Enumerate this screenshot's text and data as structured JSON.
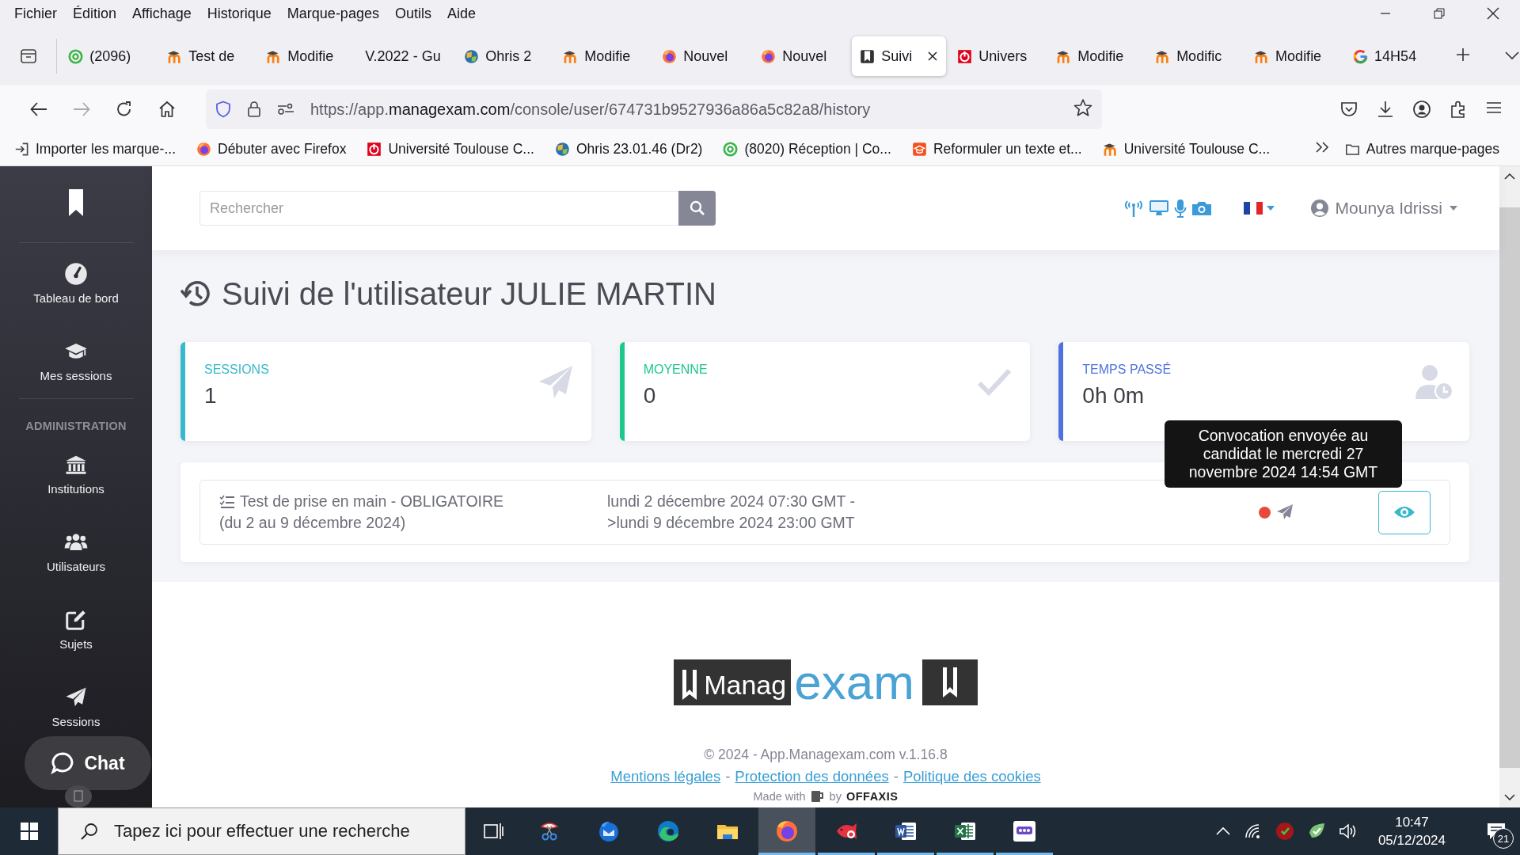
{
  "menu_bar": [
    "Fichier",
    "Édition",
    "Affichage",
    "Historique",
    "Marque-pages",
    "Outils",
    "Aide"
  ],
  "tabs": [
    {
      "label": "(2096)",
      "kind": "target",
      "selected": false
    },
    {
      "label": "Test de",
      "kind": "moodle",
      "selected": false
    },
    {
      "label": "Modifie",
      "kind": "moodle",
      "selected": false
    },
    {
      "label": "V.2022 - Gu",
      "kind": "none",
      "selected": false
    },
    {
      "label": "Ohris 2",
      "kind": "ohris",
      "selected": false
    },
    {
      "label": "Modifie",
      "kind": "moodle",
      "selected": false
    },
    {
      "label": "Nouvel",
      "kind": "firefox",
      "selected": false
    },
    {
      "label": "Nouvel",
      "kind": "firefox",
      "selected": false
    },
    {
      "label": "Suivi",
      "kind": "managexam",
      "selected": true
    },
    {
      "label": "Univers",
      "kind": "toulouse",
      "selected": false
    },
    {
      "label": "Modifie",
      "kind": "moodle",
      "selected": false
    },
    {
      "label": "Modific",
      "kind": "moodle",
      "selected": false
    },
    {
      "label": "Modifie",
      "kind": "moodle",
      "selected": false
    },
    {
      "label": "14H54",
      "kind": "google",
      "selected": false
    }
  ],
  "address_bar": {
    "prefix": "https://app.",
    "domain": "managexam.com",
    "path": "/console/user/674731b9527936a86a5c82a8/history"
  },
  "bookmarks": [
    {
      "label": "Importer les marque-...",
      "kind": "import"
    },
    {
      "label": "Débuter avec Firefox",
      "kind": "firefox"
    },
    {
      "label": "Université Toulouse C...",
      "kind": "toulouse"
    },
    {
      "label": "Ohris 23.01.46 (Dr2)",
      "kind": "ohris"
    },
    {
      "label": "(8020) Réception | Co...",
      "kind": "target"
    },
    {
      "label": "Reformuler un texte et...",
      "kind": "capsquare"
    },
    {
      "label": "Université Toulouse C...",
      "kind": "moodle"
    }
  ],
  "other_bookmarks": "Autres marque-pages",
  "sidebar": {
    "items": [
      {
        "label": "Tableau de bord",
        "kind": "gauge"
      },
      {
        "label": "Mes sessions",
        "kind": "cap"
      }
    ],
    "section": "ADMINISTRATION",
    "admin_items": [
      {
        "label": "Institutions",
        "kind": "bank"
      },
      {
        "label": "Utilisateurs",
        "kind": "users"
      },
      {
        "label": "Sujets",
        "kind": "edit"
      },
      {
        "label": "Sessions",
        "kind": "plane"
      }
    ]
  },
  "chat_button": "Chat",
  "header": {
    "search": {
      "placeholder": "Rechercher"
    },
    "user": "Mounya Idrissi"
  },
  "page_title": "Suivi de l'utilisateur JULIE MARTIN",
  "stats": [
    {
      "label": "SESSIONS",
      "value": "1",
      "kind": "plane",
      "color": "#36b9cc"
    },
    {
      "label": "MOYENNE",
      "value": "0",
      "kind": "check",
      "color": "#1cc88a"
    },
    {
      "label": "TEMPS PASSÉ",
      "value": "0h 0m",
      "kind": "userclock",
      "color": "#4e73df"
    }
  ],
  "sessions": [
    {
      "title": "Test de prise en main - OBLIGATOIRE",
      "period": "(du 2 au 9 décembre 2024)",
      "start": "lundi 2 décembre 2024 07:30 GMT -",
      "end": ">lundi 9 décembre 2024 23:00 GMT",
      "color": "#e74a3b",
      "tooltip": "Convocation envoyée au candidat le mercredi 27 novembre 2024 14:54 GMT"
    }
  ],
  "footer": {
    "logo_left": "Manag",
    "logo_right": "exam",
    "copyright": "© 2024 - App.Managexam.com v.1.16.8",
    "links": [
      "Mentions légales",
      "Protection des données",
      "Politique des cookies"
    ],
    "separator": "-",
    "made_with": "Made with",
    "by": "by",
    "brand": "OFFAXIS"
  },
  "taskbar": {
    "search": {
      "placeholder": "Tapez ici pour effectuer une recherche"
    },
    "apps": [
      {
        "kind": "snip",
        "running": false,
        "selected": false
      },
      {
        "kind": "mail",
        "running": false,
        "selected": false
      },
      {
        "kind": "edge",
        "running": false,
        "selected": false
      },
      {
        "kind": "explorer",
        "running": false,
        "selected": false
      },
      {
        "kind": "firefox",
        "running": true,
        "selected": true
      },
      {
        "kind": "fish",
        "running": true,
        "selected": false
      },
      {
        "kind": "word",
        "running": true,
        "selected": false
      },
      {
        "kind": "excel",
        "running": true,
        "selected": false
      },
      {
        "kind": "meeting",
        "running": true,
        "selected": false
      }
    ],
    "time": "10:47",
    "date": "05/12/2024",
    "notifications": "21"
  }
}
